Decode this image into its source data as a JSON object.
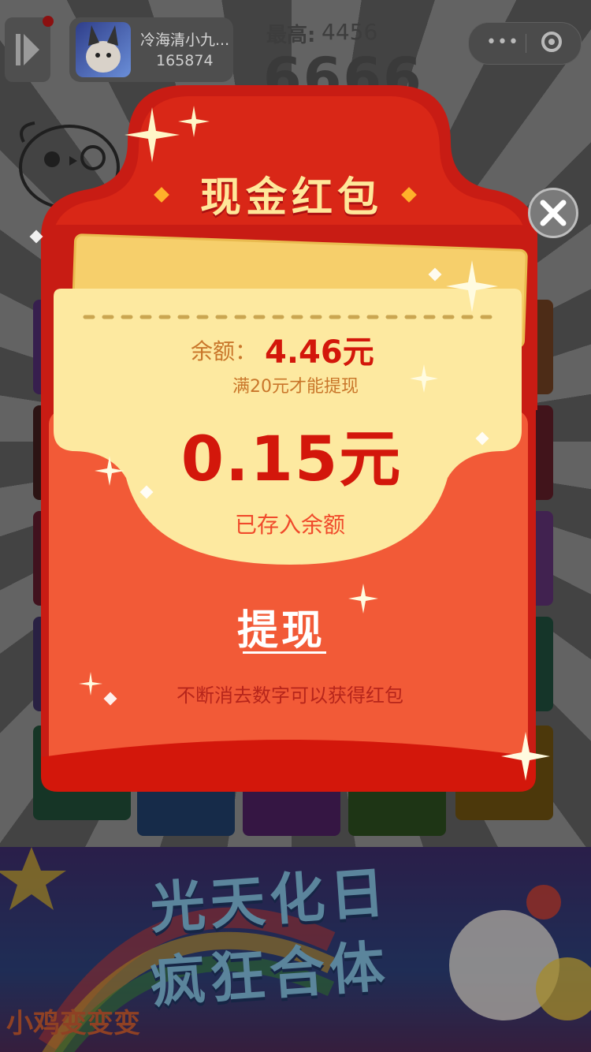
{
  "header": {
    "username": "冷海清小九...",
    "user_score": "165874",
    "best_label": "最高:",
    "best_value": "4456",
    "current_score": "6666"
  },
  "modal": {
    "title": "现金红包",
    "balance_label": "余额：",
    "balance_value": "4.46元",
    "min_withdraw_hint": "满20元才能提现",
    "amount": "0.15元",
    "deposited_text": "已存入余额",
    "withdraw_label": "提现",
    "hint_text": "不断消去数字可以获得红包"
  },
  "banner": {
    "line1": "光天化日",
    "line2": "疯狂合体",
    "logo": "小鸡变变变"
  },
  "icons": {
    "close": "close-icon",
    "play": "play-icon",
    "more": "more-dots-icon",
    "capsule_target": "target-icon"
  },
  "colors": {
    "envelope_red": "#c81c14",
    "envelope_orange": "#f25a37",
    "card_yellow": "#fde9a0",
    "amount_red": "#d3170b",
    "title_gold": "#ffe79a"
  }
}
